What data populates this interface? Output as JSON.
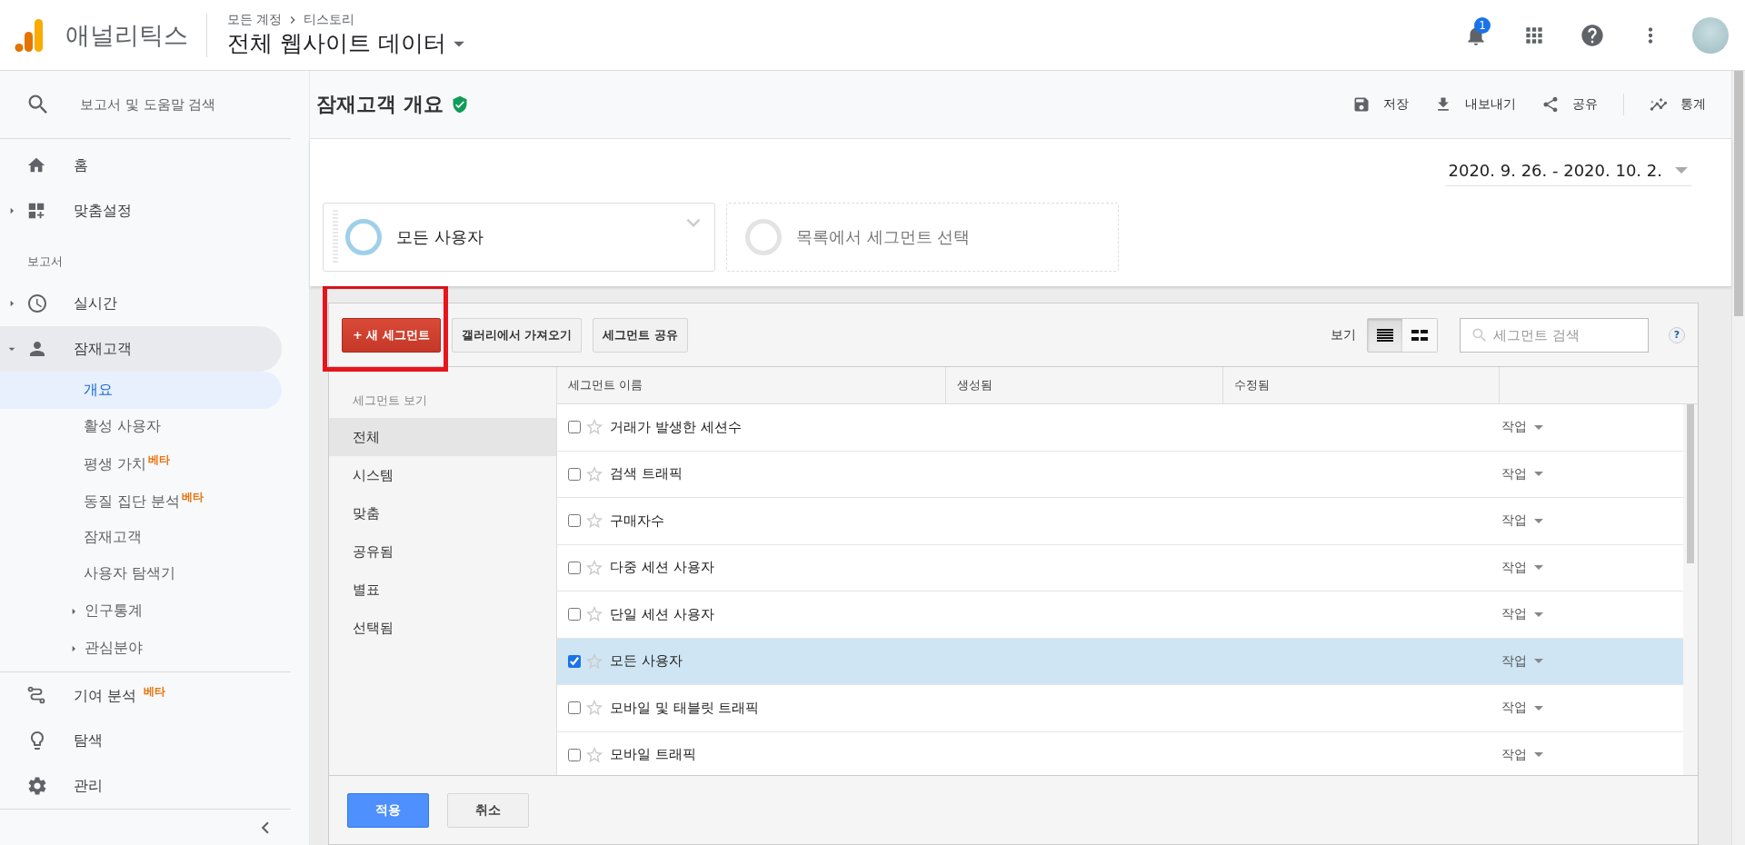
{
  "app": {
    "name": "애널리틱스",
    "breadcrumb": [
      "모든 계정",
      "티스토리"
    ],
    "view_title": "전체 웹사이트 데이터",
    "notification_count": "1"
  },
  "sidebar": {
    "search_placeholder": "보고서 및 도움말 검색",
    "top_items": [
      {
        "label": "홈",
        "kind": "link"
      },
      {
        "label": "맞춤설정",
        "kind": "group",
        "expanded": false
      }
    ],
    "section_label": "보고서",
    "reports": [
      {
        "label": "실시간",
        "kind": "group",
        "expanded": false
      },
      {
        "label": "잠재고객",
        "kind": "group",
        "expanded": true,
        "children": [
          {
            "label": "개요",
            "kind": "link",
            "selected": true
          },
          {
            "label": "활성 사용자",
            "kind": "link",
            "selected": false
          },
          {
            "label": "평생 가치",
            "kind": "link",
            "selected": false,
            "badge": "베타"
          },
          {
            "label": "동질 집단 분석",
            "kind": "link",
            "selected": false,
            "badge": "베타"
          },
          {
            "label": "잠재고객",
            "kind": "link",
            "selected": false
          },
          {
            "label": "사용자 탐색기",
            "kind": "link",
            "selected": false
          },
          {
            "label": "인구통계",
            "kind": "group",
            "expanded": false
          },
          {
            "label": "관심분야",
            "kind": "group",
            "expanded": false
          }
        ]
      }
    ],
    "bottom_items": [
      {
        "label": "기여 분석",
        "badge": "베타"
      },
      {
        "label": "탐색"
      },
      {
        "label": "관리"
      }
    ]
  },
  "page": {
    "title": "잠재고객 개요",
    "actions": [
      {
        "label": "저장"
      },
      {
        "label": "내보내기"
      },
      {
        "label": "공유"
      },
      {
        "label": "통계"
      }
    ],
    "date_range": "2020. 9. 26. - 2020. 10. 2.",
    "segments": [
      {
        "label": "모든 사용자",
        "kind": "active"
      },
      {
        "label": "목록에서 세그먼트 선택",
        "kind": "empty"
      }
    ]
  },
  "segment_editor": {
    "new_button": "+ 새 세그먼트",
    "buttons": [
      "갤러리에서 가져오기",
      "세그먼트 공유"
    ],
    "view_label": "보기",
    "view_modes": [
      {
        "selected": true
      },
      {
        "selected": false
      }
    ],
    "search_placeholder": "세그먼트 검색",
    "help": "?",
    "nav_label": "세그먼트 보기",
    "nav": [
      {
        "label": "전체",
        "selected": true
      },
      {
        "label": "시스템",
        "selected": false
      },
      {
        "label": "맞춤",
        "selected": false
      },
      {
        "label": "공유됨",
        "selected": false
      },
      {
        "label": "별표",
        "selected": false
      },
      {
        "label": "선택됨",
        "selected": false
      }
    ],
    "columns": [
      "세그먼트 이름",
      "생성됨",
      "수정됨"
    ],
    "rows": [
      {
        "name": "거래가 발생한 세션수",
        "checked": false,
        "starred": false,
        "action": "작업"
      },
      {
        "name": "검색 트래픽",
        "checked": false,
        "starred": false,
        "action": "작업"
      },
      {
        "name": "구매자수",
        "checked": false,
        "starred": false,
        "action": "작업"
      },
      {
        "name": "다중 세션 사용자",
        "checked": false,
        "starred": false,
        "action": "작업"
      },
      {
        "name": "단일 세션 사용자",
        "checked": false,
        "starred": false,
        "action": "작업"
      },
      {
        "name": "모든 사용자",
        "checked": true,
        "starred": false,
        "action": "작업"
      },
      {
        "name": "모바일 및 태블릿 트래픽",
        "checked": false,
        "starred": false,
        "action": "작업"
      },
      {
        "name": "모바일 트래픽",
        "checked": false,
        "starred": false,
        "action": "작업"
      }
    ],
    "footer_buttons": [
      {
        "label": "적용",
        "kind": "primary"
      },
      {
        "label": "취소",
        "kind": "secondary"
      }
    ]
  }
}
